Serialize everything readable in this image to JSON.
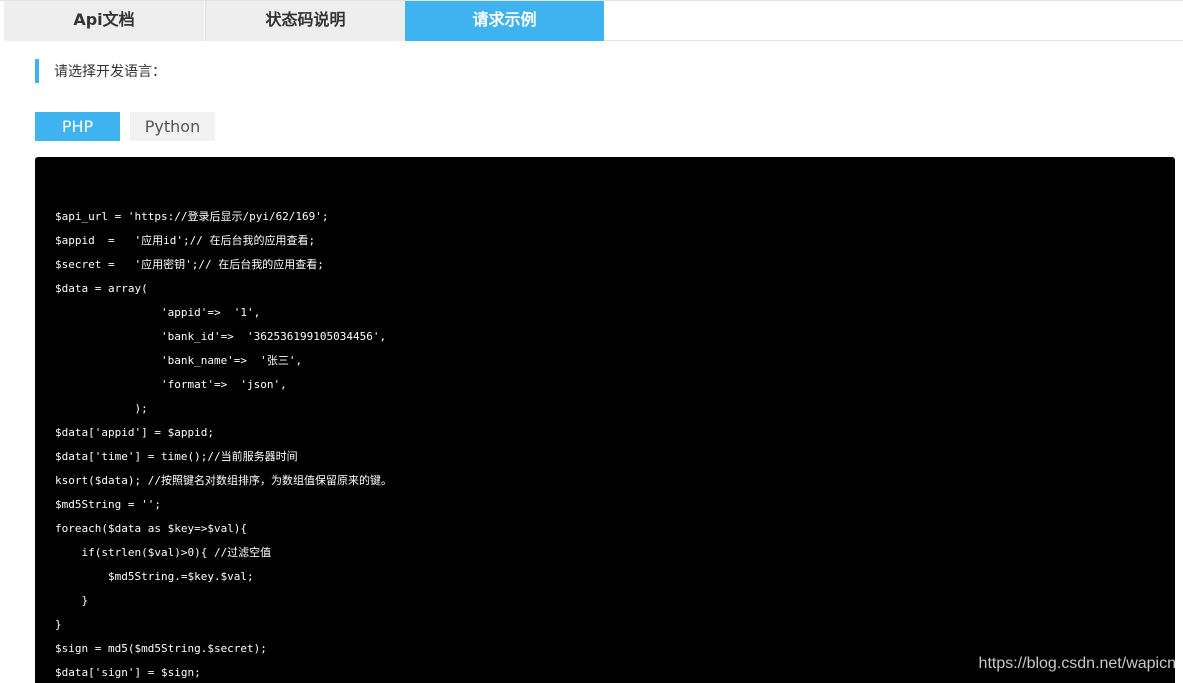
{
  "tabs": [
    {
      "label": "Api文档"
    },
    {
      "label": "状态码说明"
    },
    {
      "label": "请求示例",
      "active": true
    }
  ],
  "language_prompt": "请选择开发语言：",
  "languages": [
    {
      "label": "PHP",
      "active": true
    },
    {
      "label": "Python"
    }
  ],
  "code_lines": [
    "$api_url = 'https://登录后显示/pyi/62/169';",
    "$appid  =   '应用id';// 在后台我的应用查看;",
    "$secret =   '应用密钥';// 在后台我的应用查看;",
    "$data = array(",
    "                'appid'=>  '1',",
    "                'bank_id'=>  '362536199105034456',",
    "                'bank_name'=>  '张三',",
    "                'format'=>  'json',",
    "            );",
    "$data['appid'] = $appid;",
    "$data['time'] = time();//当前服务器时间",
    "ksort($data); //按照键名对数组排序，为数组值保留原来的键。",
    "$md5String = '';",
    "foreach($data as $key=>$val){",
    "    if(strlen($val)>0){ //过滤空值",
    "        $md5String.=$key.$val;",
    "    }",
    "}",
    "$sign = md5($md5String.$secret);",
    "$data['sign'] = $sign;"
  ],
  "watermark": "https://blog.csdn.net/wapicn",
  "colors": {
    "accent": "#3fb3f0",
    "code_bg": "#000000",
    "code_text": "#ffffff"
  }
}
